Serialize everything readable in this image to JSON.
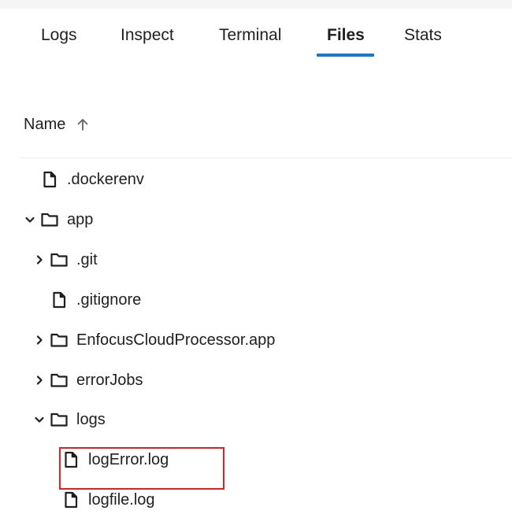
{
  "tabs": [
    {
      "label": "Logs",
      "active": false
    },
    {
      "label": "Inspect",
      "active": false
    },
    {
      "label": "Terminal",
      "active": false
    },
    {
      "label": "Files",
      "active": true
    },
    {
      "label": "Stats",
      "active": false
    }
  ],
  "file_table": {
    "column_header": "Name",
    "sort_direction": "ascending",
    "rows": [
      {
        "name": ".dockerenv",
        "type": "file",
        "expanded": null
      },
      {
        "name": "app",
        "type": "folder",
        "expanded": true
      },
      {
        "name": ".git",
        "type": "folder",
        "expanded": false
      },
      {
        "name": ".gitignore",
        "type": "file",
        "expanded": null
      },
      {
        "name": "EnfocusCloudProcessor.app",
        "type": "folder",
        "expanded": false
      },
      {
        "name": "errorJobs",
        "type": "folder",
        "expanded": false
      },
      {
        "name": "logs",
        "type": "folder",
        "expanded": true
      },
      {
        "name": "logError.log",
        "type": "file",
        "expanded": null,
        "highlighted": true
      },
      {
        "name": "logfile.log",
        "type": "file",
        "expanded": null
      }
    ]
  },
  "colors": {
    "accent": "#1976d2",
    "highlight": "#e02020",
    "text": "#1f1f1f",
    "icon": "#1f1f1f"
  }
}
